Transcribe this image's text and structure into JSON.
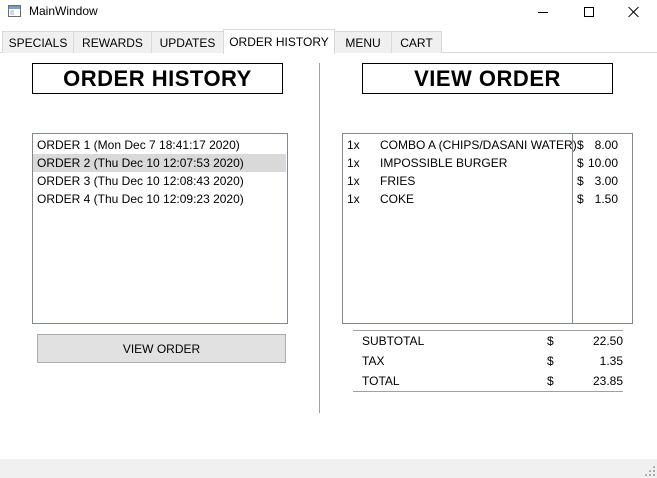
{
  "window": {
    "title": "MainWindow",
    "icon": "app-window-icon",
    "controls": {
      "minimize": "minimize-icon",
      "maximize": "maximize-icon",
      "close": "close-icon"
    }
  },
  "tabs": [
    {
      "label": "SPECIALS",
      "active": false
    },
    {
      "label": "REWARDS",
      "active": false
    },
    {
      "label": "UPDATES",
      "active": false
    },
    {
      "label": "ORDER HISTORY",
      "active": true
    },
    {
      "label": "MENU",
      "active": false
    },
    {
      "label": "CART",
      "active": false
    }
  ],
  "order_history": {
    "heading": "ORDER HISTORY",
    "orders": [
      {
        "label": "ORDER 1 (Mon Dec 7 18:41:17 2020)",
        "selected": false
      },
      {
        "label": "ORDER 2 (Thu Dec 10 12:07:53 2020)",
        "selected": true
      },
      {
        "label": "ORDER 3 (Thu Dec 10 12:08:43 2020)",
        "selected": false
      },
      {
        "label": "ORDER 4 (Thu Dec 10 12:09:23 2020)",
        "selected": false
      }
    ],
    "view_button_label": "VIEW ORDER"
  },
  "view_order": {
    "heading": "VIEW ORDER",
    "items": [
      {
        "qty": "1x",
        "name": "COMBO A (CHIPS/DASANI WATER)",
        "currency": "$",
        "price": "8.00"
      },
      {
        "qty": "1x",
        "name": "IMPOSSIBLE BURGER",
        "currency": "$",
        "price": "10.00"
      },
      {
        "qty": "1x",
        "name": "FRIES",
        "currency": "$",
        "price": "3.00"
      },
      {
        "qty": "1x",
        "name": "COKE",
        "currency": "$",
        "price": "1.50"
      }
    ],
    "totals": {
      "subtotal": {
        "label": "SUBTOTAL",
        "currency": "$",
        "value": "22.50"
      },
      "tax": {
        "label": "TAX",
        "currency": "$",
        "value": "1.35"
      },
      "total": {
        "label": "TOTAL",
        "currency": "$",
        "value": "23.85"
      }
    }
  },
  "colors": {
    "selection": "#d9d9d9",
    "button_face": "#e1e1e1",
    "tab_inactive": "#f0f0f0",
    "border": "#828790"
  }
}
